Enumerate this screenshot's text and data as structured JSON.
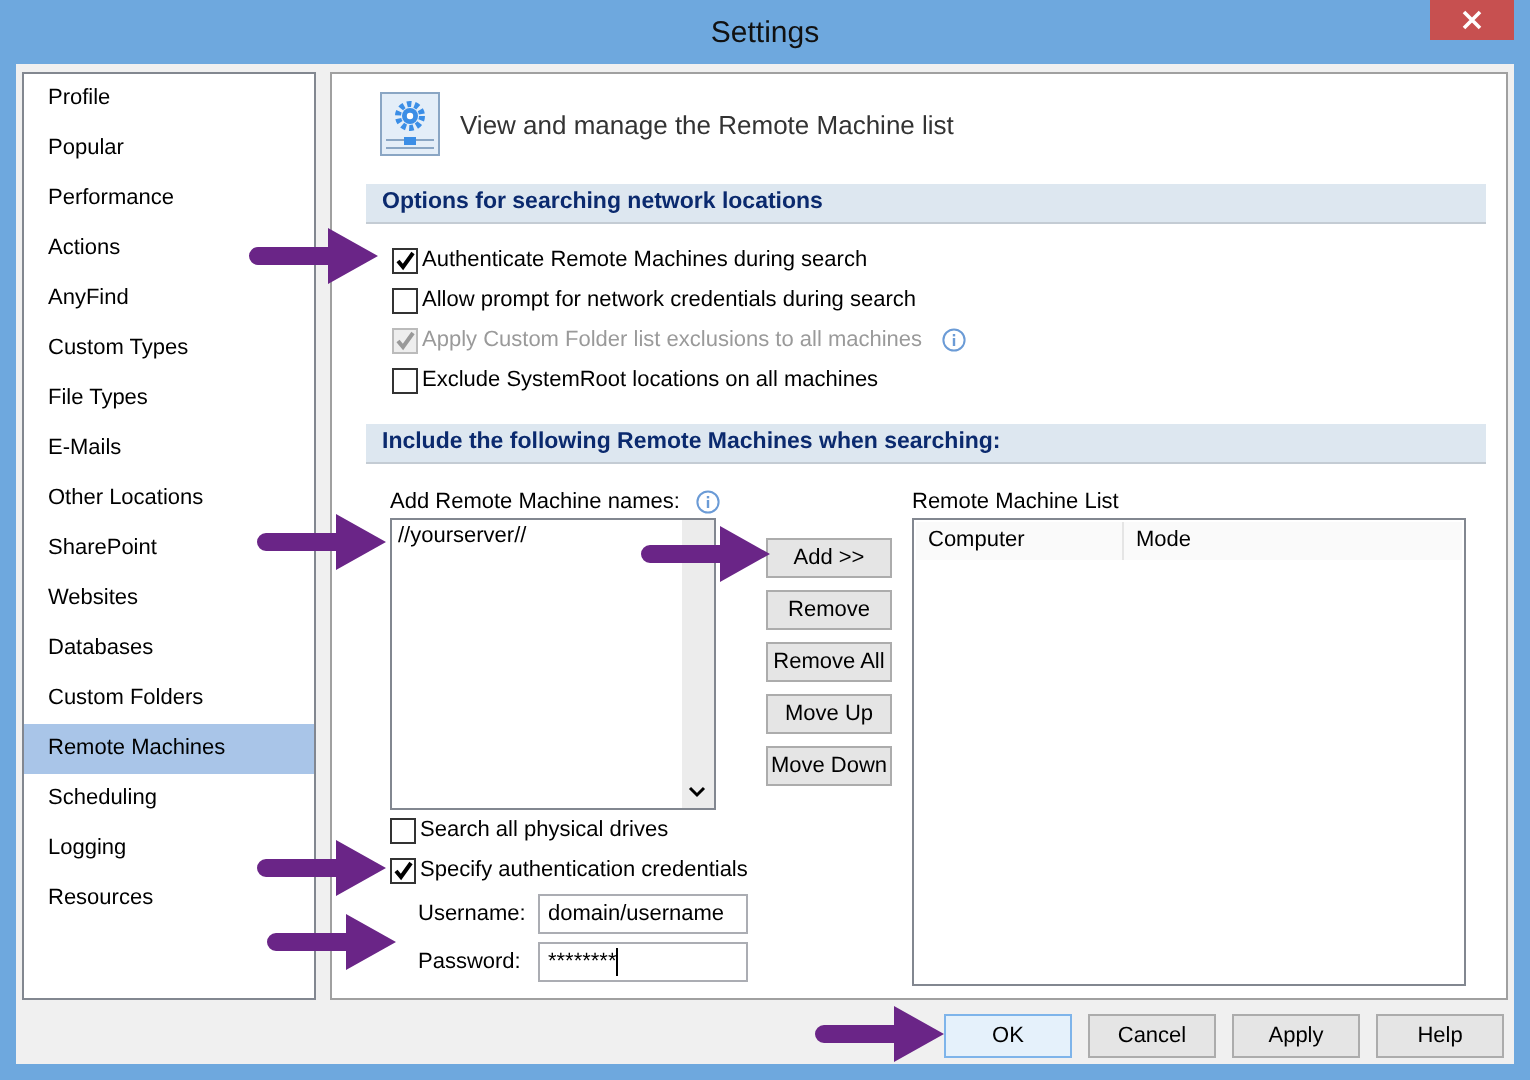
{
  "window": {
    "title": "Settings"
  },
  "sidebar": {
    "items": [
      {
        "label": "Profile",
        "selected": false
      },
      {
        "label": "Popular",
        "selected": false
      },
      {
        "label": "Performance",
        "selected": false
      },
      {
        "label": "Actions",
        "selected": false
      },
      {
        "label": "AnyFind",
        "selected": false
      },
      {
        "label": "Custom Types",
        "selected": false
      },
      {
        "label": "File Types",
        "selected": false
      },
      {
        "label": "E-Mails",
        "selected": false
      },
      {
        "label": "Other Locations",
        "selected": false
      },
      {
        "label": "SharePoint",
        "selected": false
      },
      {
        "label": "Websites",
        "selected": false
      },
      {
        "label": "Databases",
        "selected": false
      },
      {
        "label": "Custom Folders",
        "selected": false
      },
      {
        "label": "Remote Machines",
        "selected": true
      },
      {
        "label": "Scheduling",
        "selected": false
      },
      {
        "label": "Logging",
        "selected": false
      },
      {
        "label": "Resources",
        "selected": false
      }
    ]
  },
  "panel": {
    "heading": "View and manage the Remote Machine list",
    "search_options": {
      "title": "Options for searching network locations",
      "options": [
        {
          "label": "Authenticate Remote Machines during search",
          "checked": true,
          "disabled": false,
          "info": false
        },
        {
          "label": "Allow prompt for network credentials during search",
          "checked": false,
          "disabled": false,
          "info": false
        },
        {
          "label": "Apply Custom Folder list exclusions to all machines",
          "checked": true,
          "disabled": true,
          "info": true
        },
        {
          "label": "Exclude SystemRoot locations on all machines",
          "checked": false,
          "disabled": false,
          "info": false
        }
      ]
    },
    "machines": {
      "title": "Include the following Remote Machines when searching:",
      "names_label": "Add Remote Machine names:",
      "names_value": "//yourserver//",
      "buttons": [
        "Add >>",
        "Remove",
        "Remove All",
        "Move Up",
        "Move Down"
      ],
      "list_title": "Remote Machine List",
      "columns": [
        "Computer",
        "Mode"
      ],
      "options": [
        {
          "label": "Search all physical drives",
          "checked": false
        },
        {
          "label": "Specify authentication credentials",
          "checked": true
        }
      ],
      "username": {
        "label": "Username:",
        "value": "domain/username"
      },
      "password": {
        "label": "Password:",
        "value": "********"
      }
    }
  },
  "footer": {
    "buttons": [
      {
        "label": "OK",
        "default": true
      },
      {
        "label": "Cancel",
        "default": false
      },
      {
        "label": "Apply",
        "default": false
      },
      {
        "label": "Help",
        "default": false
      }
    ]
  }
}
